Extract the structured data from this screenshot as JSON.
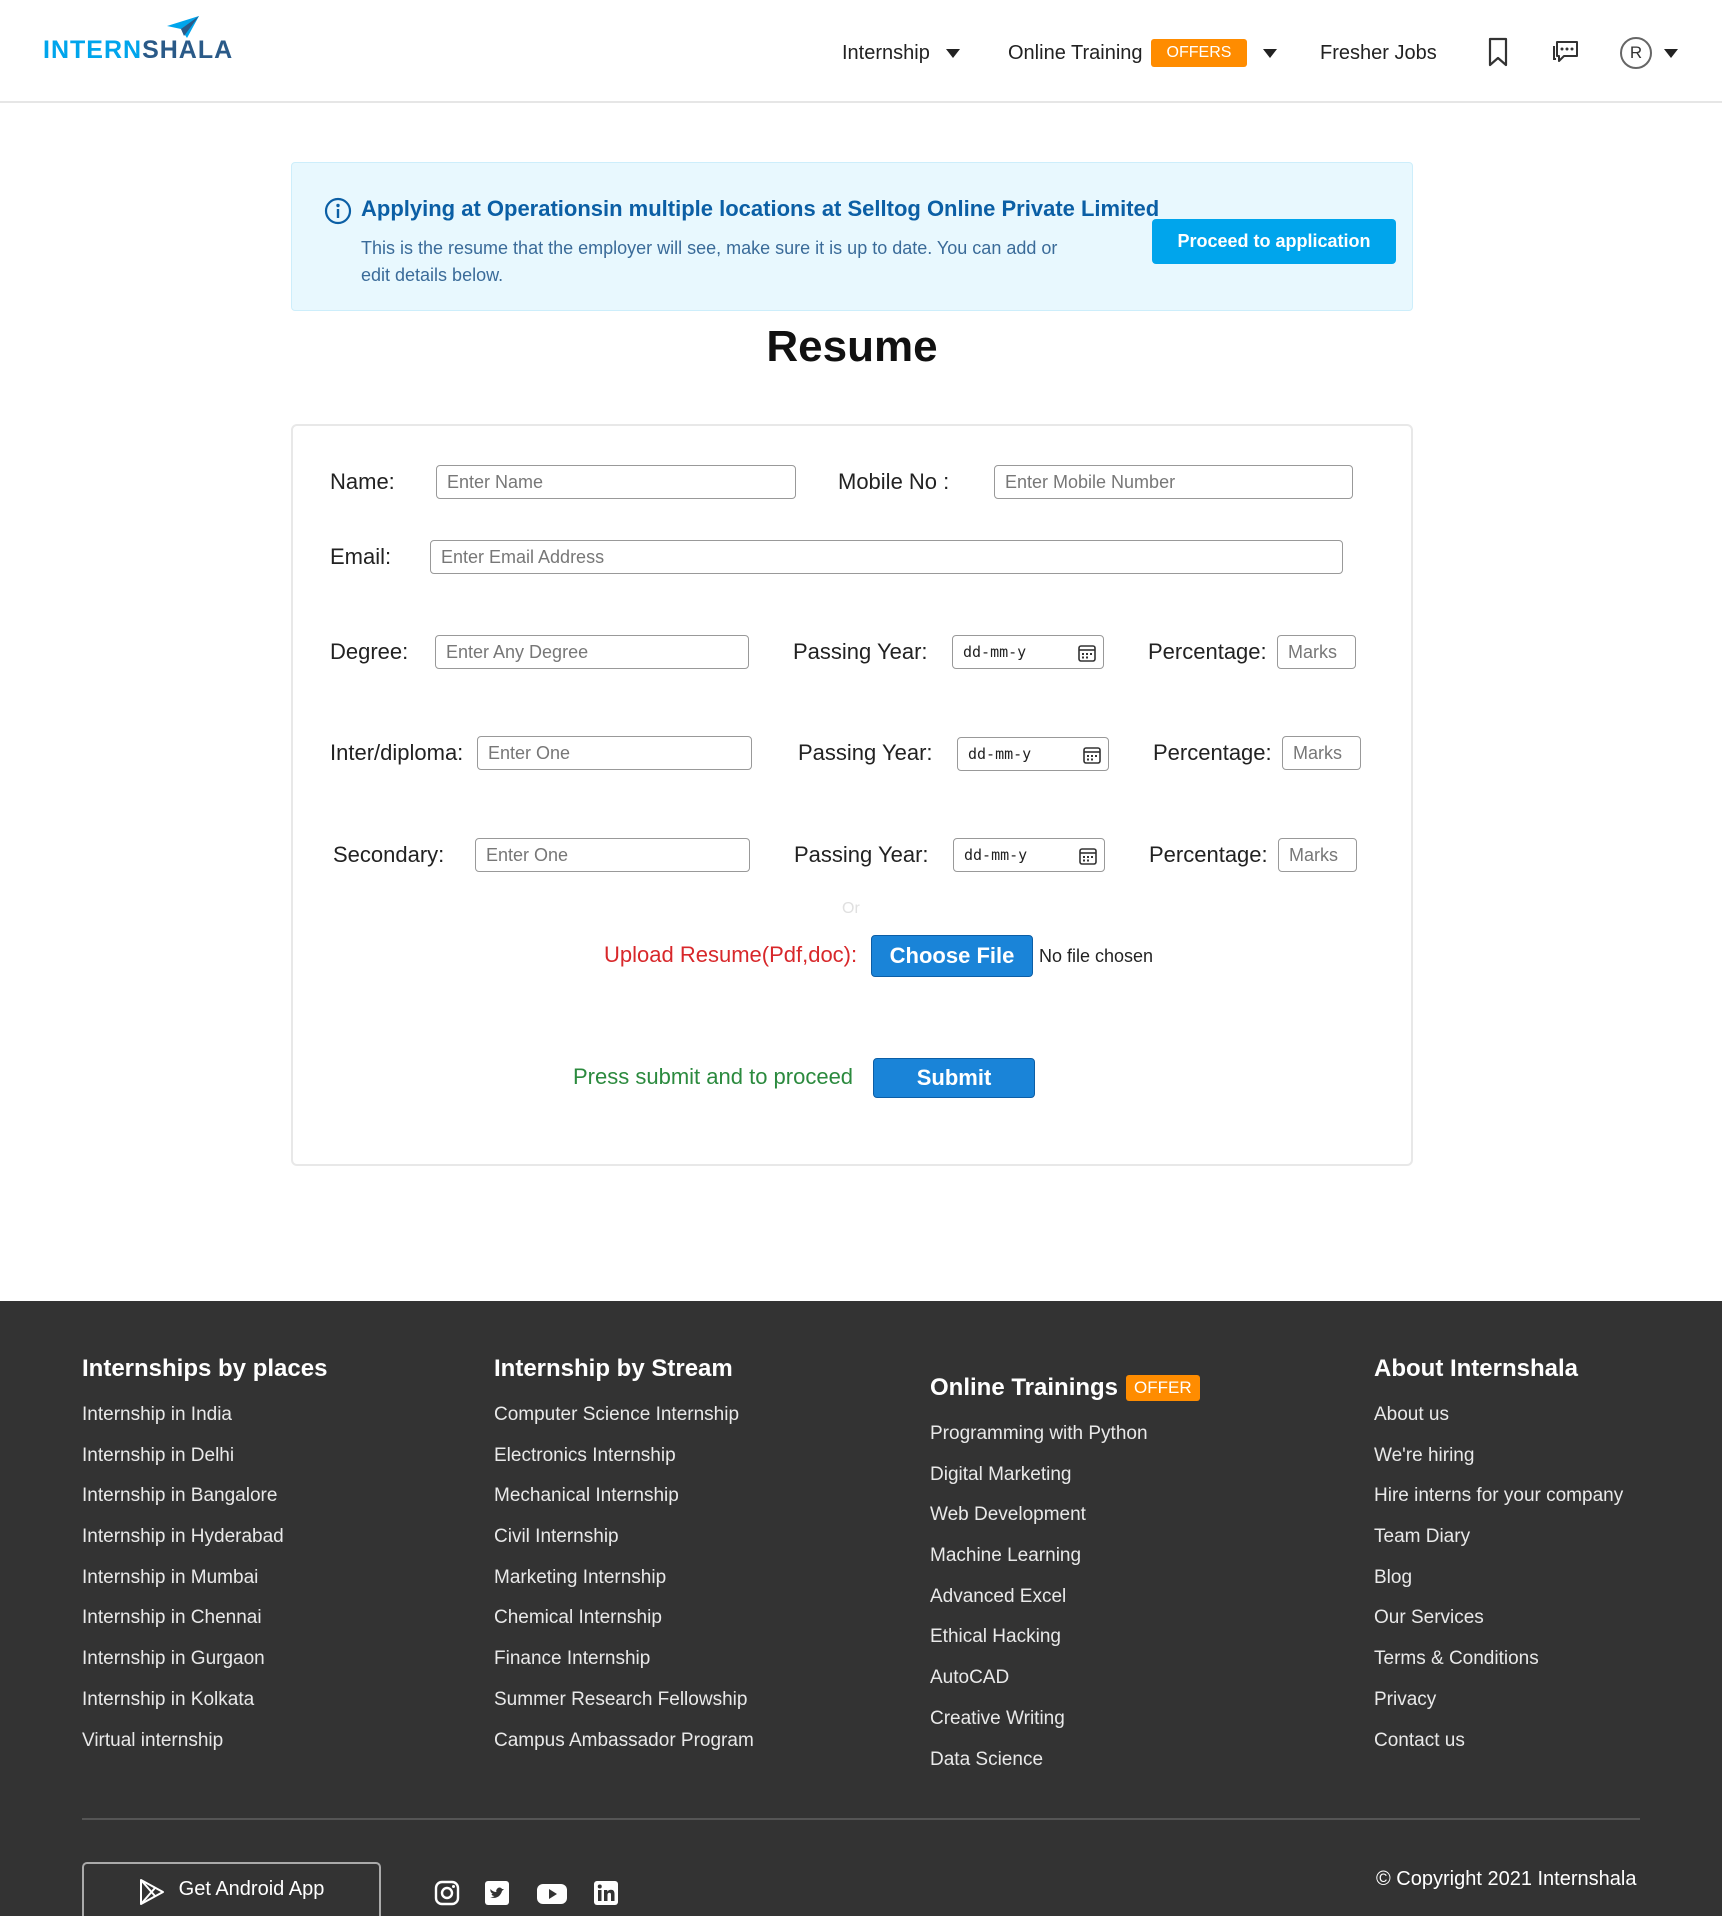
{
  "header": {
    "logo": {
      "part1": "INTERN",
      "part2": "SHALA"
    },
    "nav": {
      "internship": "Internship",
      "online_training": "Online Training",
      "offers_badge": "OFFERS",
      "fresher_jobs": "Fresher Jobs"
    },
    "avatar_initial": "R",
    "icons": [
      "bookmark-icon",
      "chat-icon"
    ]
  },
  "banner": {
    "title": "Applying at Operationsin multiple locations at Selltog Online Private Limited",
    "text": "This is the resume that the employer will see, make sure it is up to date. You can add or edit details below.",
    "proceed_label": "Proceed to application"
  },
  "page_title": "Resume",
  "form": {
    "name": {
      "label": "Name:",
      "placeholder": "Enter Name"
    },
    "mobile": {
      "label": "Mobile No :",
      "placeholder": "Enter Mobile Number"
    },
    "email": {
      "label": "Email:",
      "placeholder": "Enter Email Address"
    },
    "degree": {
      "label": "Degree:",
      "placeholder": "Enter Any Degree",
      "year_label": "Passing Year:",
      "year_value": "dd-mm-y",
      "pct_label": "Percentage:",
      "pct_placeholder": "Marks"
    },
    "inter": {
      "label": "Inter/diploma:",
      "placeholder": "Enter One",
      "year_label": "Passing Year:",
      "year_value": "dd-mm-y",
      "pct_label": "Percentage:",
      "pct_placeholder": "Marks"
    },
    "secondary": {
      "label": "Secondary:",
      "placeholder": "Enter One",
      "year_label": "Passing Year:",
      "year_value": "dd-mm-y",
      "pct_label": "Percentage:",
      "pct_placeholder": "Marks"
    },
    "or_text": "Or",
    "upload_label": "Upload Resume(Pdf,doc):",
    "choose_file_label": "Choose File",
    "no_file_text": "No file chosen",
    "press_text": "Press submit and to proceed",
    "submit_label": "Submit"
  },
  "footer": {
    "places": {
      "title": "Internships by places",
      "links": [
        "Internship in India",
        "Internship in Delhi",
        "Internship in Bangalore",
        "Internship in Hyderabad",
        "Internship in Mumbai",
        "Internship in Chennai",
        "Internship in Gurgaon",
        "Internship in Kolkata",
        "Virtual internship"
      ]
    },
    "stream": {
      "title": "Internship by Stream",
      "links": [
        "Computer Science Internship",
        "Electronics Internship",
        "Mechanical Internship",
        "Civil Internship",
        "Marketing Internship",
        "Chemical Internship",
        "Finance Internship",
        "Summer Research Fellowship",
        "Campus Ambassador Program"
      ]
    },
    "trainings": {
      "title": "Online Trainings",
      "badge": "OFFER",
      "links": [
        "Programming with Python",
        "Digital Marketing",
        "Web Development",
        "Machine Learning",
        "Advanced Excel",
        "Ethical Hacking",
        "AutoCAD",
        "Creative Writing",
        "Data Science"
      ]
    },
    "about": {
      "title": "About Internshala",
      "links": [
        "About us",
        "We're hiring",
        "Hire interns for your company",
        "Team Diary",
        "Blog",
        "Our Services",
        "Terms & Conditions",
        "Privacy",
        "Contact us"
      ]
    },
    "android_label": "Get Android App",
    "social_icons": [
      "instagram-icon",
      "twitter-icon",
      "youtube-icon",
      "linkedin-icon"
    ],
    "copyright": "© Copyright 2021 Internshala"
  },
  "colors": {
    "brand_blue": "#00a5ec",
    "brand_dark": "#2a5a88",
    "offer_orange": "#ff8c00",
    "footer_bg": "#333333",
    "upload_red": "#d8282b",
    "press_green": "#2b8a3e"
  }
}
